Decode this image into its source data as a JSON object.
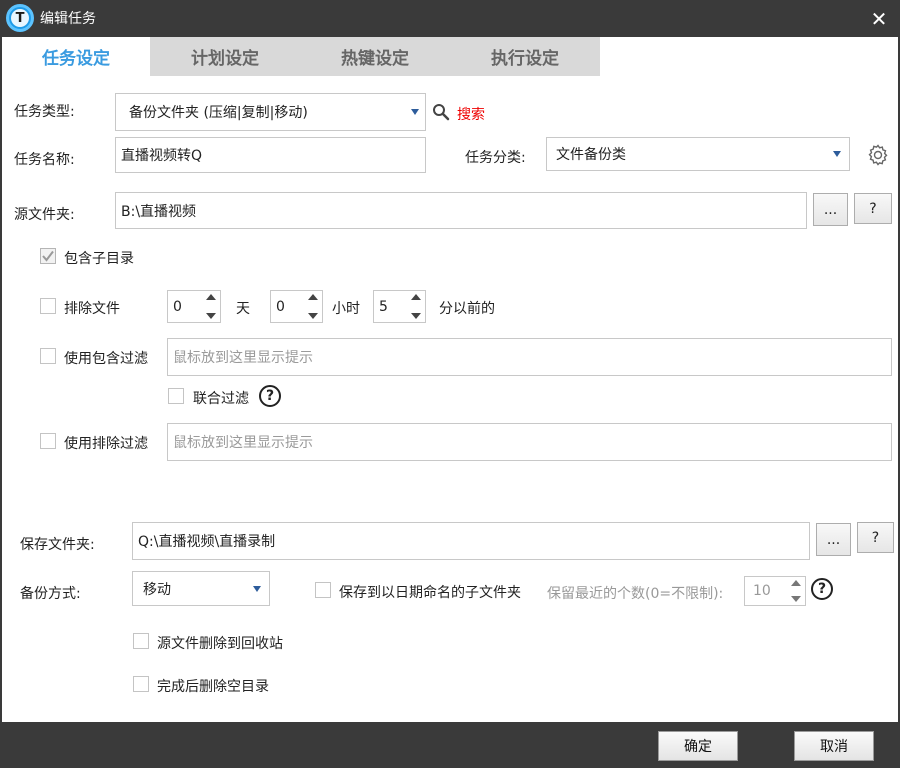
{
  "window": {
    "title": "编辑任务",
    "close_label": "✕",
    "app_icon_letter": "T"
  },
  "tabs": [
    {
      "label": "任务设定",
      "active": true
    },
    {
      "label": "计划设定",
      "active": false
    },
    {
      "label": "热键设定",
      "active": false
    },
    {
      "label": "执行设定",
      "active": false
    }
  ],
  "task_type": {
    "label": "任务类型:",
    "value": "备份文件夹 (压缩|复制|移动)",
    "search_label": "搜索"
  },
  "task_name": {
    "label": "任务名称:",
    "value": "直播视频转Q"
  },
  "task_category": {
    "label": "任务分类:",
    "value": "文件备份类"
  },
  "source_folder": {
    "label": "源文件夹:",
    "value": "B:\\直播视频",
    "browse_label": "...",
    "help_label": "?"
  },
  "include_subdirs": {
    "label": "包含子目录",
    "checked": true
  },
  "exclude_files": {
    "label": "排除文件",
    "checked": false,
    "days_value": "0",
    "days_unit": "天",
    "hours_value": "0",
    "hours_unit": "小时",
    "minutes_value": "5",
    "minutes_unit": "分以前的"
  },
  "include_filter": {
    "label": "使用包含过滤",
    "checked": false,
    "placeholder": "鼠标放到这里显示提示"
  },
  "joint_filter": {
    "label": "联合过滤",
    "checked": false,
    "help_label": "?"
  },
  "exclude_filter": {
    "label": "使用排除过滤",
    "checked": false,
    "placeholder": "鼠标放到这里显示提示"
  },
  "save_folder": {
    "label": "保存文件夹:",
    "value": "Q:\\直播视频\\直播录制",
    "browse_label": "...",
    "help_label": "?"
  },
  "backup_method": {
    "label": "备份方式:",
    "value": "移动"
  },
  "date_subfolder": {
    "label": "保存到以日期命名的子文件夹",
    "checked": false
  },
  "keep_recent": {
    "label": "保留最近的个数(0=不限制):",
    "value": "10",
    "help_label": "?"
  },
  "delete_to_recycle": {
    "label": "源文件删除到回收站",
    "checked": false
  },
  "delete_empty_dirs": {
    "label": "完成后删除空目录",
    "checked": false
  },
  "footer": {
    "ok_label": "确定",
    "cancel_label": "取消"
  },
  "colors": {
    "titlebar": "#3a3a3a",
    "active_tab_text": "#3a9be0",
    "tab_strip": "#d9d9d9",
    "search_link": "#ee0000"
  }
}
